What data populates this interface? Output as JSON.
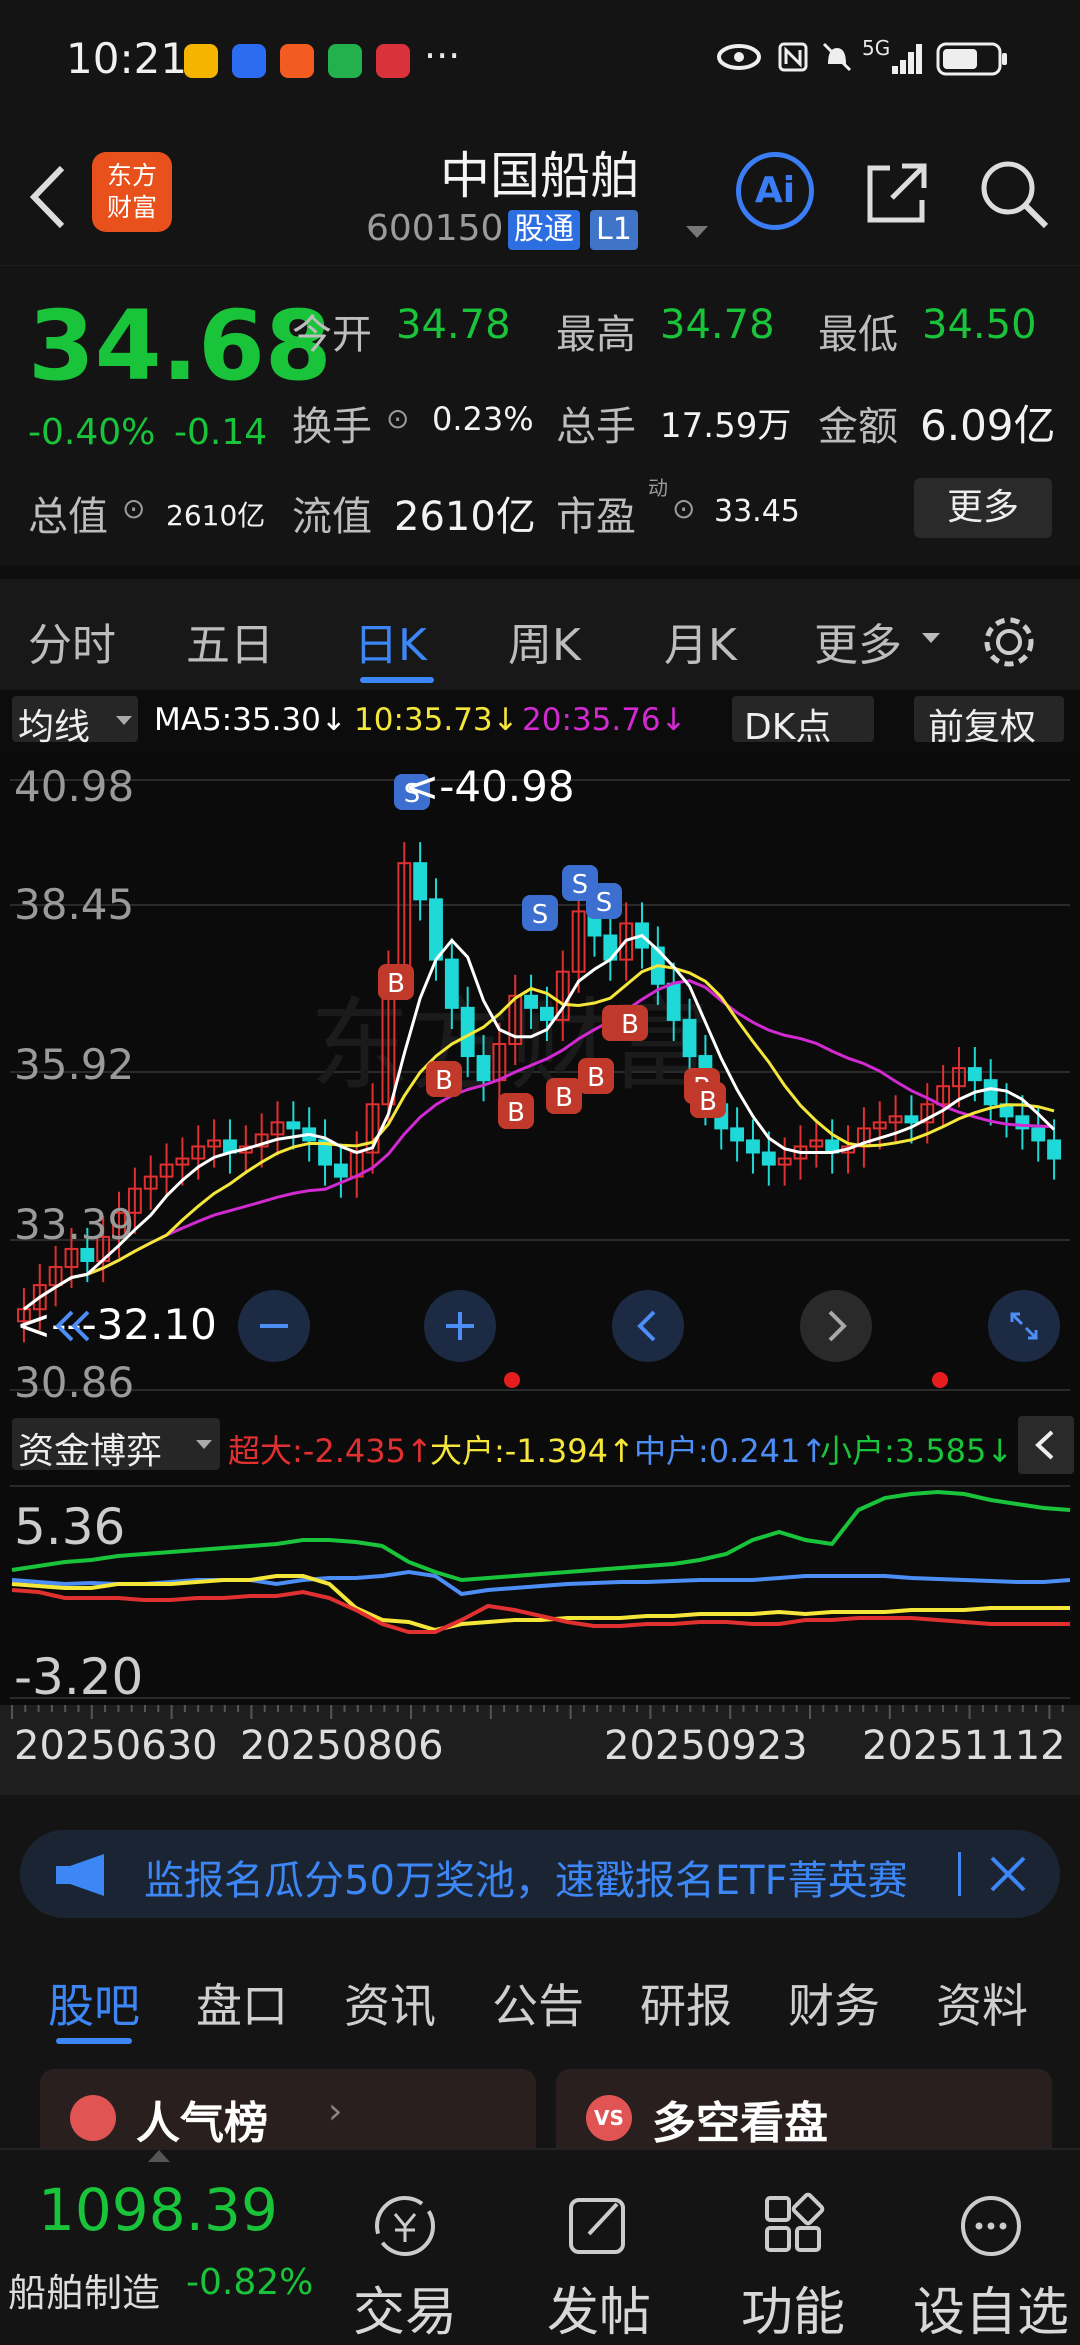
{
  "status": {
    "time": "10:21",
    "dots": "···",
    "network": "5G"
  },
  "header": {
    "title": "中国船舶",
    "code": "600150",
    "tag_tong": "股通",
    "tag_level": "L1",
    "logo_text": "东方财富",
    "ai_label": "Ai"
  },
  "quote": {
    "price": "34.68",
    "pct": "-0.40%",
    "chg": "-0.14",
    "open_label": "今开",
    "open": "34.78",
    "high_label": "最高",
    "high": "34.78",
    "low_label": "最低",
    "low": "34.50",
    "turnover_label": "换手",
    "turnover": "0.23%",
    "volume_label": "总手",
    "volume": "17.59万",
    "amount_label": "金额",
    "amount": "6.09亿",
    "mktcap_label": "总值",
    "mktcap": "2610亿",
    "float_label": "流值",
    "float": "2610亿",
    "pe_label": "市盈",
    "pe_sup": "动",
    "pe": "33.45",
    "more": "更多"
  },
  "tabs": [
    "分时",
    "五日",
    "日K",
    "周K",
    "月K",
    "更多"
  ],
  "active_tab": "日K",
  "ma_bar": {
    "selector": "均线",
    "ma5": "MA5:35.30↓",
    "ma10": "10:35.73↓",
    "ma20": "20:35.76↓",
    "dk": "DK点",
    "adjust": "前复权"
  },
  "kline": {
    "yticks": [
      "40.98",
      "38.45",
      "35.92",
      "33.39",
      "30.86"
    ],
    "max_label": "<-40.98",
    "min_label": "<---32.10",
    "watermark": "东方财富"
  },
  "fund": {
    "selector": "资金博弈",
    "super": "超大:-2.435↑",
    "big": "大户:-1.394↑",
    "mid": "中户:0.241↑",
    "small": "小户:3.585↓",
    "ytop": "5.36",
    "ybot": "-3.20"
  },
  "dates": [
    "20250630",
    "20250806",
    "20250923",
    "20251112"
  ],
  "banner": {
    "text": "监报名瓜分50万奖池，速戳报名ETF菁英赛"
  },
  "subtabs": [
    "股吧",
    "盘口",
    "资讯",
    "公告",
    "研报",
    "财务",
    "资料"
  ],
  "active_subtab": "股吧",
  "cards": {
    "left": "人气榜",
    "right": "多空看盘",
    "left_badge": "",
    "right_badge": "VS"
  },
  "bottom": {
    "index_value": "1098.39",
    "index_name": "船舶制造",
    "index_pct": "-0.82%",
    "buttons": [
      "交易",
      "发帖",
      "功能",
      "设自选"
    ]
  },
  "colors": {
    "up": "#e03030",
    "down": "#19c43a",
    "accent": "#4c8df6",
    "ma5": "#ffffff",
    "ma10": "#f5e63a",
    "ma20": "#d12ad1"
  }
}
